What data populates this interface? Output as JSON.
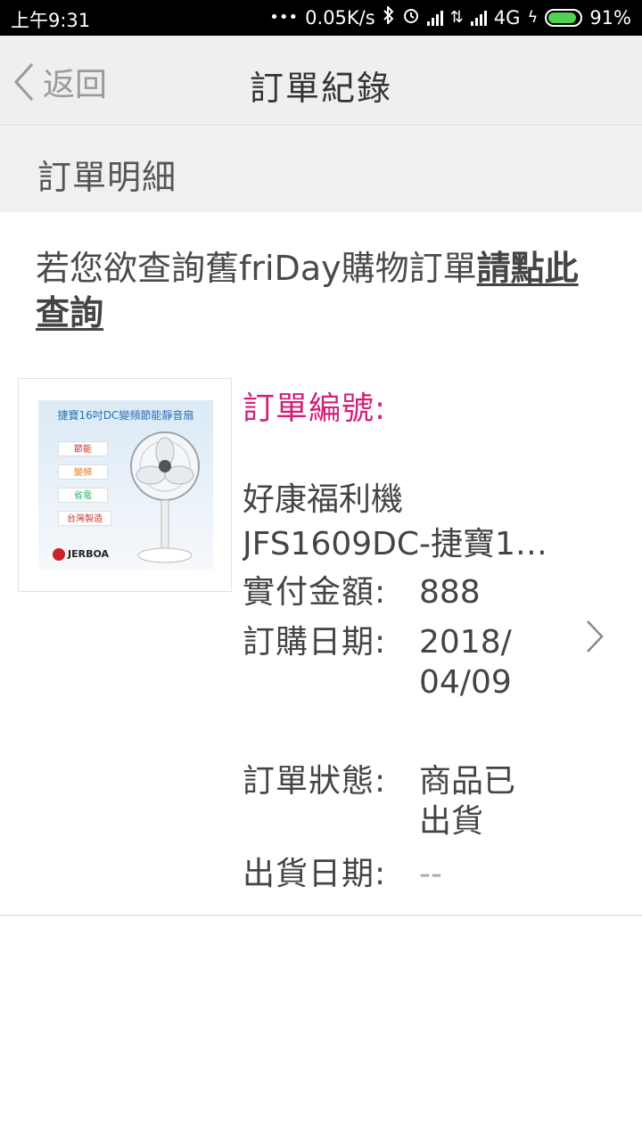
{
  "status_bar": {
    "time": "上午9:31",
    "network_speed": "0.05K/s",
    "network_type": "4G",
    "battery": "91%",
    "battery_level": 0.91,
    "icons": [
      "more-dots-icon",
      "bluetooth-icon",
      "alarm-icon",
      "signal-icon",
      "data-transfer-icon",
      "signal-icon",
      "charging-icon",
      "battery-icon"
    ]
  },
  "header": {
    "back_label": "返回",
    "title": "訂單紀錄"
  },
  "section": {
    "title": "訂單明細"
  },
  "notice": {
    "text": "若您欲查詢舊friDay購物訂單",
    "link": "請點此查詢"
  },
  "product_image": {
    "title": "捷寶16吋DC變頻節能靜音扇",
    "tags": [
      "節能",
      "變頻",
      "省電",
      "台灣製造"
    ],
    "brand": "JERBOA"
  },
  "order": {
    "order_no_label": "訂單編號:",
    "product_name": "好康福利機",
    "product_model": "JFS1609DC-捷寶1…",
    "paid_label": "實付金額:",
    "paid_value": "888",
    "date_label": "訂購日期:",
    "date_value_1": "2018/",
    "date_value_2": "04/09",
    "status_label": "訂單狀態:",
    "status_value_1": "商品已",
    "status_value_2": "出貨",
    "ship_label": "出貨日期:",
    "ship_value": "--"
  },
  "colors": {
    "accent": "#d4207a",
    "header_bg": "#efefef",
    "status_bar_bg": "#000000",
    "battery_green": "#4fd24f"
  }
}
